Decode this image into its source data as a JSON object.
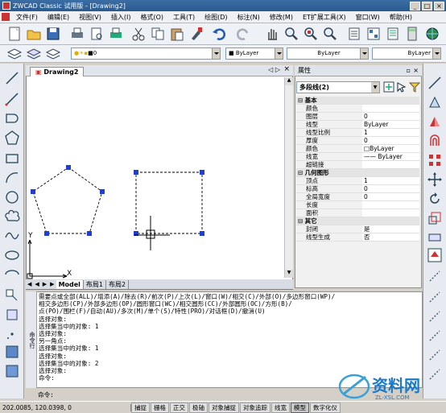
{
  "window": {
    "title": "ZWCAD Classic 试用版 - [Drawing2]"
  },
  "menu": [
    "文件(F)",
    "编辑(E)",
    "视图(V)",
    "插入(I)",
    "格式(O)",
    "工具(T)",
    "绘图(D)",
    "标注(N)",
    "修改(M)",
    "ET扩展工具(X)",
    "窗口(W)",
    "帮助(H)"
  ],
  "layer_bar": {
    "layer_value": "0",
    "color_value": "ByLayer",
    "linetype_value": "ByLayer",
    "lineweight_value": "ByLayer"
  },
  "drawing": {
    "tab": "Drawing2",
    "ucs_x": "X",
    "ucs_y": "Y",
    "layout_tabs": [
      "Model",
      "布局1",
      "布局2"
    ]
  },
  "properties": {
    "title": "属性",
    "selection": "多段线(2)",
    "sections": [
      {
        "name": "基本",
        "rows": [
          {
            "k": "颜色",
            "v": ""
          },
          {
            "k": "图层",
            "v": "0"
          },
          {
            "k": "线型",
            "v": "ByLayer"
          },
          {
            "k": "线型比例",
            "v": "1"
          },
          {
            "k": "厚度",
            "v": "0"
          },
          {
            "k": "颜色",
            "v": "ByLayer"
          },
          {
            "k": "线宽",
            "v": "—— ByLayer"
          },
          {
            "k": "超链接",
            "v": ""
          }
        ]
      },
      {
        "name": "几何图形",
        "rows": [
          {
            "k": "顶点",
            "v": "1"
          },
          {
            "k": "标高",
            "v": "0"
          },
          {
            "k": "全局宽度",
            "v": "0"
          },
          {
            "k": "长度",
            "v": ""
          },
          {
            "k": "面积",
            "v": ""
          }
        ]
      },
      {
        "name": "其它",
        "rows": [
          {
            "k": "封闭",
            "v": "是"
          },
          {
            "k": "线型生成",
            "v": "否"
          }
        ]
      }
    ]
  },
  "command": {
    "side_label": "命令行",
    "lines": [
      "需要点或全部(ALL)/增添(A)/除去(R)/前次(P)/上次(L)/窗口(W)/相交(C)/外部(O)/多边形窗口(WP)/",
      "相交多边形(CP)/外部多边形(OP)/圆形窗口(WC)/相交圆形(CC)/外部圆形(OC)/方形(B)/",
      "点(PO)/围栏(F)/自动(AU)/多次(M)/单个(S)/特性(PRO)/对话框(D)/撤消(U)",
      "选择对象:",
      "选择集当中的对象: 1",
      "选择对象:",
      "另一角点:",
      "选择集当中的对象: 1",
      "选择对象:",
      "选择集当中的对象: 2",
      "选择对象:",
      "命令:"
    ],
    "prompt": "命令:"
  },
  "status": {
    "coords": "202.0085, 120.0398, 0",
    "buttons": [
      {
        "label": "捕捉",
        "on": false
      },
      {
        "label": "栅格",
        "on": false
      },
      {
        "label": "正交",
        "on": false
      },
      {
        "label": "极轴",
        "on": false
      },
      {
        "label": "对象捕捉",
        "on": false
      },
      {
        "label": "对象追踪",
        "on": false
      },
      {
        "label": "线宽",
        "on": false
      },
      {
        "label": "模型",
        "on": true
      },
      {
        "label": "数字化仪",
        "on": false
      }
    ]
  },
  "watermark": {
    "text": "资料网",
    "domain": "ZL-XSL.COM"
  }
}
